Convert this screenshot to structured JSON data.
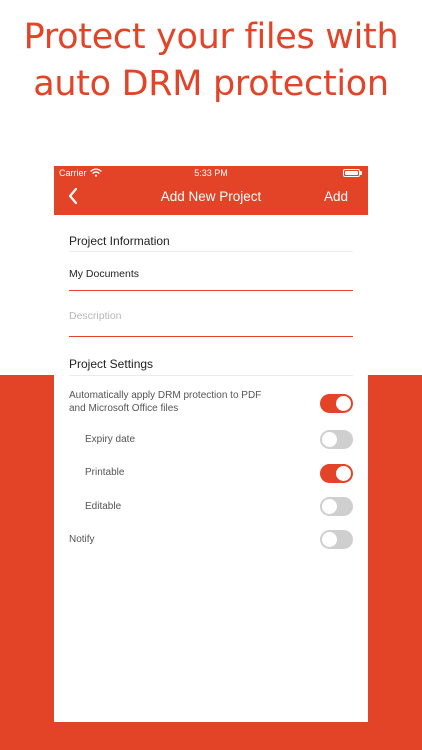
{
  "headline": {
    "line1": "Protect your files with",
    "line2": "auto DRM protection"
  },
  "status_bar": {
    "carrier": "Carrier",
    "time": "5:33 PM"
  },
  "nav": {
    "title": "Add New Project",
    "add_label": "Add"
  },
  "project_info": {
    "title": "Project Information",
    "name_value": "My Documents",
    "description_placeholder": "Description"
  },
  "project_settings": {
    "title": "Project Settings",
    "rows": [
      {
        "label_line1": "Automatically apply DRM protection to PDF",
        "label_line2": "and Microsoft Office files",
        "on": true
      },
      {
        "label": "Expiry date",
        "on": false
      },
      {
        "label": "Printable",
        "on": true
      },
      {
        "label": "Editable",
        "on": false
      },
      {
        "label": "Notify",
        "on": false
      }
    ]
  },
  "colors": {
    "accent": "#e34326",
    "toggle_off": "#cfcfcf"
  }
}
